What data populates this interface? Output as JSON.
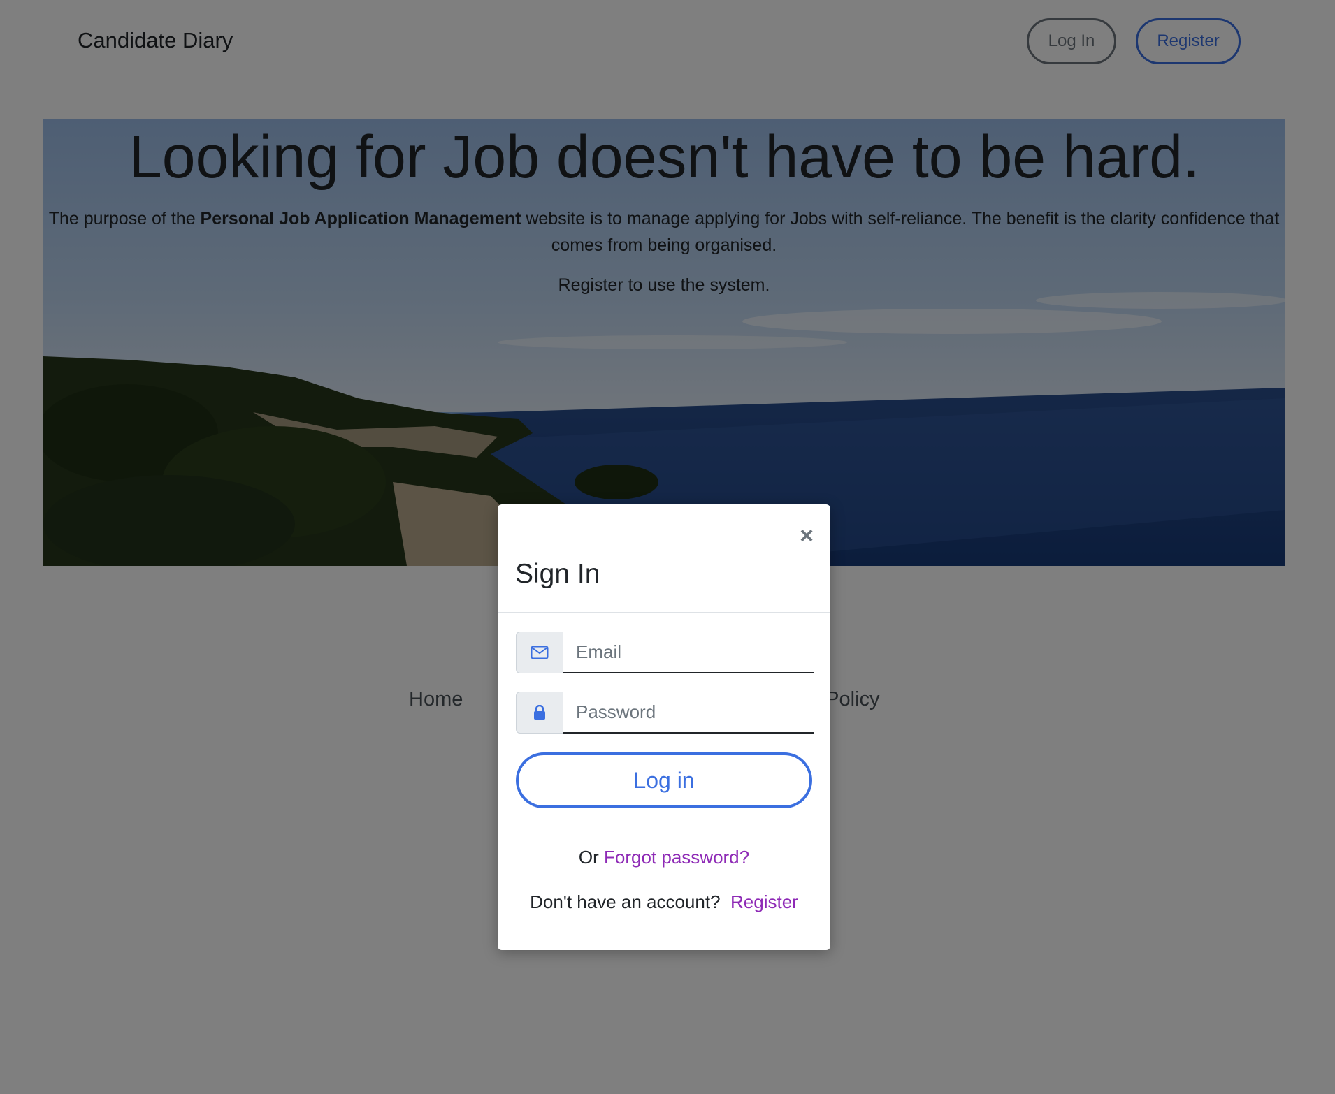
{
  "header": {
    "brand": "Candidate Diary",
    "login_label": "Log In",
    "register_label": "Register"
  },
  "hero": {
    "title": "Looking for Job doesn't have to be hard.",
    "desc_prefix": "The purpose of the ",
    "desc_bold": "Personal Job Application Management",
    "desc_suffix": " website is to manage applying for Jobs with self-reliance. The benefit is the clarity confidence that comes from being organised.",
    "register_prompt": "Register to use the system."
  },
  "footer": {
    "home_label": "Home",
    "privacy_label": "acy Policy"
  },
  "modal": {
    "title": "Sign In",
    "close_symbol": "×",
    "email_placeholder": "Email",
    "password_placeholder": "Password",
    "login_button": "Log in",
    "forgot_prefix": "Or ",
    "forgot_link": "Forgot password?",
    "register_prefix": "Don't have an account?",
    "register_link": "Register"
  },
  "icons": {
    "email": "envelope-icon",
    "password": "lock-icon"
  },
  "colors": {
    "accent": "#3b6fe0",
    "link": "#8e2ab6",
    "backdrop": "rgba(0,0,0,0.5)"
  }
}
